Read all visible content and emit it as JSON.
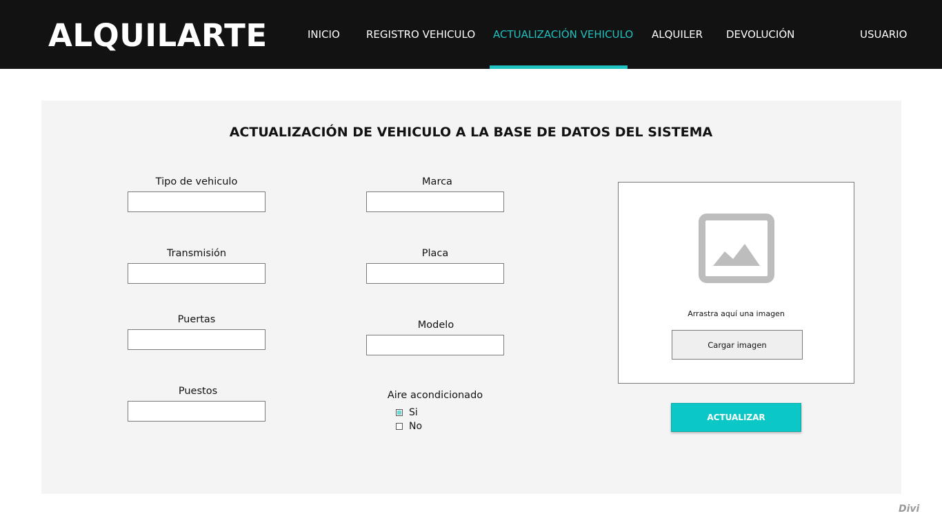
{
  "header": {
    "logo": "ALQUILARTE",
    "nav": [
      {
        "label": "INICIO",
        "active": false
      },
      {
        "label": "REGISTRO VEHICULO",
        "active": false
      },
      {
        "label": "ACTUALIZACIÓN VEHICULO",
        "active": true
      },
      {
        "label": "ALQUILER",
        "active": false
      },
      {
        "label": "DEVOLUCIÓN",
        "active": false
      },
      {
        "label": "USUARIO",
        "active": false
      }
    ]
  },
  "form": {
    "title": "ACTUALIZACIÓN DE VEHICULO A LA BASE DE DATOS DEL SISTEMA",
    "left_column": [
      {
        "label": "Tipo de vehiculo",
        "value": ""
      },
      {
        "label": "Transmisión",
        "value": ""
      },
      {
        "label": "Puertas",
        "value": ""
      },
      {
        "label": "Puestos",
        "value": ""
      }
    ],
    "middle_column": [
      {
        "label": "Marca",
        "value": ""
      },
      {
        "label": "Placa",
        "value": ""
      },
      {
        "label": "Modelo",
        "value": ""
      }
    ],
    "aire": {
      "label": "Aire acondicionado",
      "options": [
        {
          "label": "Si",
          "checked": true
        },
        {
          "label": "No",
          "checked": false
        }
      ]
    },
    "image_upload": {
      "icon": "image-placeholder-icon",
      "drop_text": "Arrastra aquí una imagen",
      "button_label": "Cargar imagen"
    },
    "submit_label": "ACTUALIZAR"
  },
  "watermark": "Divi",
  "colors": {
    "header_bg": "#121212",
    "accent": "#1fc2c0",
    "button": "#0bc8c6",
    "panel_bg": "#f4f4f4",
    "caret": "#6fd6d1"
  }
}
